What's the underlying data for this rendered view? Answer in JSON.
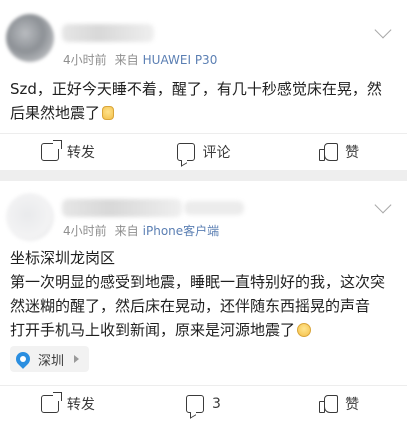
{
  "posts": [
    {
      "time": "4小时前",
      "from_label": "来自",
      "source": "HUAWEI P30",
      "lines": [
        "Szd，正好今天睡不着，醒了，有几十秒感觉床在晃，然",
        "后果然地震了"
      ],
      "emoji": "sleepy-emoji",
      "actions": {
        "repost": "转发",
        "comment": "评论",
        "like": "赞"
      }
    },
    {
      "time": "4小时前",
      "from_label": "来自",
      "source": "iPhone客户端",
      "lines": [
        "坐标深圳龙岗区",
        "第一次明显的感受到地震，睡眠一直特别好的我，这次突",
        "然迷糊的醒了，然后床在晃动，还伴随东西摇晃的声音",
        "打开手机马上收到新闻，原来是河源地震了"
      ],
      "emoji": "sad-emoji",
      "location": "深圳",
      "actions": {
        "repost": "转发",
        "comment": "3",
        "like": "赞"
      }
    }
  ]
}
